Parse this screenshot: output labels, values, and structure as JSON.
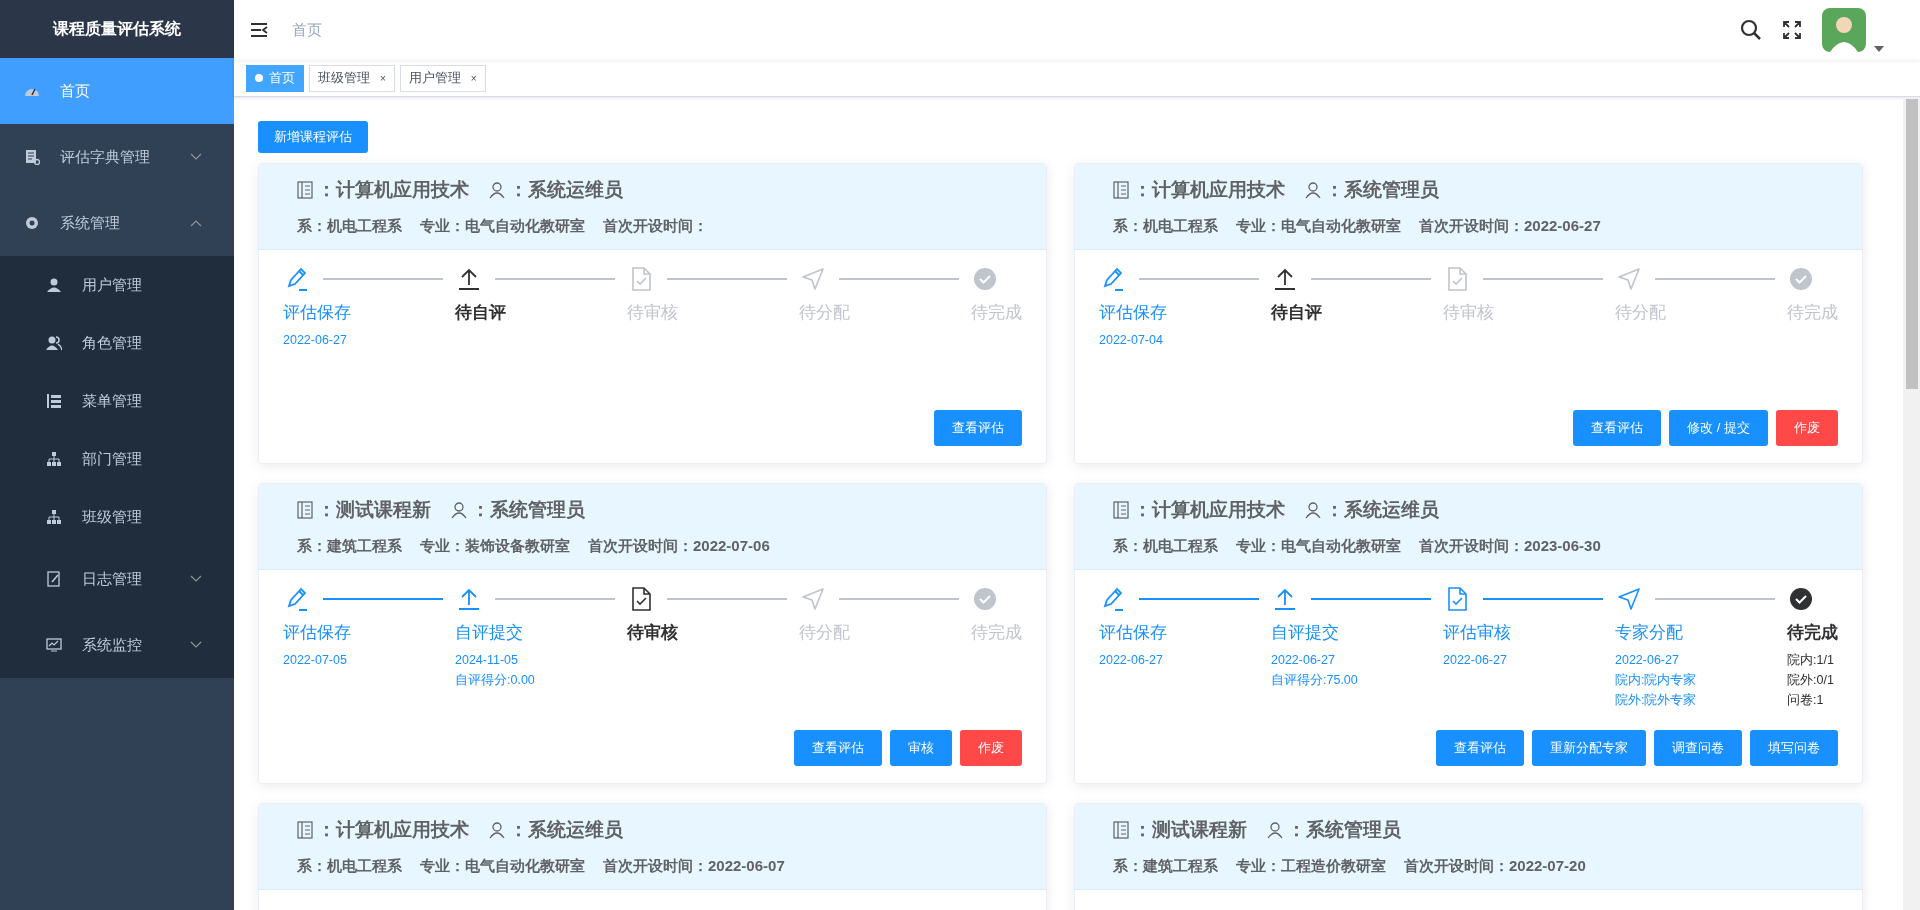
{
  "sidebar": {
    "title": "课程质量评估系统",
    "items": [
      {
        "label": "首页",
        "selected": true
      },
      {
        "label": "评估字典管理",
        "selected": false,
        "expanded": false
      },
      {
        "label": "系统管理",
        "selected": false,
        "expanded": true,
        "children": [
          {
            "label": "用户管理",
            "selected": false
          },
          {
            "label": "角色管理",
            "selected": false
          },
          {
            "label": "菜单管理",
            "selected": false
          },
          {
            "label": "部门管理",
            "selected": false
          },
          {
            "label": "班级管理",
            "selected": false
          },
          {
            "label": "日志管理",
            "selected": false,
            "expanded": false
          },
          {
            "label": "系统监控",
            "selected": false,
            "expanded": false
          }
        ]
      }
    ]
  },
  "header": {
    "breadcrumb": "首页"
  },
  "tags": [
    {
      "label": "首页",
      "selected": true
    },
    {
      "label": "班级管理",
      "selected": false,
      "close": "×"
    },
    {
      "label": "用户管理",
      "selected": false,
      "close": "×"
    }
  ],
  "add_button": "新增课程评估",
  "cards": [
    {
      "course": "：计算机应用技术",
      "user": "：系统运维员",
      "dept": "系：机电工程系",
      "major": "专业：电气自动化教研室",
      "start_time": "首次开设时间：",
      "steps": [
        {
          "title": "评估保存",
          "done": true,
          "current": false,
          "details": [
            "2022-06-27"
          ]
        },
        {
          "title": "待自评",
          "done": false,
          "current": true
        },
        {
          "title": "待审核",
          "done": false,
          "current": false
        },
        {
          "title": "待分配",
          "done": false,
          "current": false
        },
        {
          "title": "待完成",
          "done": false,
          "current": false
        }
      ],
      "buttons": [
        {
          "label": "查看评估",
          "kind": "primary"
        }
      ]
    },
    {
      "course": "：计算机应用技术",
      "user": "：系统管理员",
      "dept": "系：机电工程系",
      "major": "专业：电气自动化教研室",
      "start_time": "首次开设时间：2022-06-27",
      "steps": [
        {
          "title": "评估保存",
          "done": true,
          "current": false,
          "details": [
            "2022-07-04"
          ]
        },
        {
          "title": "待自评",
          "done": false,
          "current": true
        },
        {
          "title": "待审核",
          "done": false,
          "current": false
        },
        {
          "title": "待分配",
          "done": false,
          "current": false
        },
        {
          "title": "待完成",
          "done": false,
          "current": false
        }
      ],
      "buttons": [
        {
          "label": "查看评估",
          "kind": "primary"
        },
        {
          "label": "修改 / 提交",
          "kind": "primary"
        },
        {
          "label": "作废",
          "kind": "danger"
        }
      ]
    },
    {
      "course": "：测试课程新",
      "user": "：系统管理员",
      "dept": "系：建筑工程系",
      "major": "专业：装饰设备教研室",
      "start_time": "首次开设时间：2022-07-06",
      "steps": [
        {
          "title": "评估保存",
          "done": true,
          "current": false,
          "details": [
            "2022-07-05"
          ]
        },
        {
          "title": "自评提交",
          "done": true,
          "current": false,
          "details": [
            "2024-11-05",
            "自评得分:0.00"
          ]
        },
        {
          "title": "待审核",
          "done": false,
          "current": true
        },
        {
          "title": "待分配",
          "done": false,
          "current": false
        },
        {
          "title": "待完成",
          "done": false,
          "current": false
        }
      ],
      "buttons": [
        {
          "label": "查看评估",
          "kind": "primary"
        },
        {
          "label": "审核",
          "kind": "primary"
        },
        {
          "label": "作废",
          "kind": "danger"
        }
      ]
    },
    {
      "course": "：计算机应用技术",
      "user": "：系统运维员",
      "dept": "系：机电工程系",
      "major": "专业：电气自动化教研室",
      "start_time": "首次开设时间：2023-06-30",
      "steps": [
        {
          "title": "评估保存",
          "done": true,
          "current": false,
          "details": [
            "2022-06-27"
          ]
        },
        {
          "title": "自评提交",
          "done": true,
          "current": false,
          "details": [
            "2022-06-27",
            "自评得分:75.00"
          ]
        },
        {
          "title": "评估审核",
          "done": true,
          "current": false,
          "details": [
            "2022-06-27"
          ]
        },
        {
          "title": "专家分配",
          "done": true,
          "current": false,
          "details": [
            "2022-06-27",
            "院内:院内专家",
            "院外:院外专家"
          ]
        },
        {
          "title": "待完成",
          "done": false,
          "current": true,
          "details": [
            "院内:1/1",
            "院外:0/1",
            "问卷:1"
          ]
        }
      ],
      "buttons": [
        {
          "label": "查看评估",
          "kind": "primary"
        },
        {
          "label": "重新分配专家",
          "kind": "primary"
        },
        {
          "label": "调查问卷",
          "kind": "primary"
        },
        {
          "label": "填写问卷",
          "kind": "primary"
        }
      ]
    },
    {
      "course": "：计算机应用技术",
      "user": "：系统运维员",
      "dept": "系：机电工程系",
      "major": "专业：电气自动化教研室",
      "start_time": "首次开设时间：2022-06-07"
    },
    {
      "course": "：测试课程新",
      "user": "：系统管理员",
      "dept": "系：建筑工程系",
      "major": "专业：工程造价教研室",
      "start_time": "首次开设时间：2022-07-20"
    }
  ]
}
